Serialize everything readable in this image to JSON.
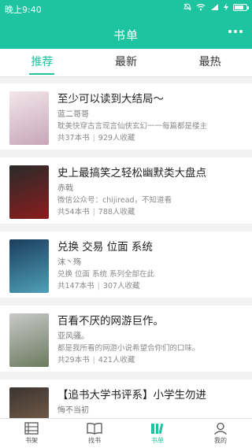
{
  "status": {
    "time": "晚上9:40"
  },
  "header": {
    "title": "书单"
  },
  "tabs": [
    {
      "label": "推荐"
    },
    {
      "label": "最新"
    },
    {
      "label": "最热"
    }
  ],
  "books": [
    {
      "title": "至少可以读到大结局～",
      "author": "蓝二哥哥",
      "desc": "耽美快穿古言现言仙侠玄幻一一每篇都是楼主",
      "count": "共37本书",
      "collect": "929人收藏",
      "cover_colors": [
        "#f3e6ea",
        "#c7a6b8"
      ]
    },
    {
      "title": "史上最搞笑之轻松幽默类大盘点",
      "author": "赤戟",
      "desc": "微信公众号：chijiread，不知道看",
      "count": "共54本书",
      "collect": "788人收藏",
      "cover_colors": [
        "#2a2a2a",
        "#8a1d1d"
      ]
    },
    {
      "title": "兑换  交易  位面  系统",
      "author": "沫丶殇",
      "desc": "兑换 位面 系统 系列全部在此",
      "count": "共147本书",
      "collect": "307人收藏",
      "cover_colors": [
        "#1b3d5c",
        "#4fa0b8"
      ]
    },
    {
      "title": "百看不厌的网游巨作。",
      "author": "亚风骚。",
      "desc": "都是我所看的网游小说希望合你们的口味。",
      "count": "共29本书",
      "collect": "421人收藏",
      "cover_colors": [
        "#c9c9c9",
        "#6b7a5e"
      ]
    },
    {
      "title": "【追书大学书评系】小学生勿进",
      "author": "悔不当初",
      "desc": "",
      "count": "",
      "collect": "",
      "cover_colors": [
        "#3a3430",
        "#8a6b52"
      ]
    }
  ],
  "nav": [
    {
      "label": "书架",
      "icon": "bookshelf-icon"
    },
    {
      "label": "找书",
      "icon": "open-book-icon"
    },
    {
      "label": "书单",
      "icon": "booklist-icon"
    },
    {
      "label": "我的",
      "icon": "person-icon"
    }
  ],
  "colors": {
    "accent": "#1ec4a0"
  }
}
